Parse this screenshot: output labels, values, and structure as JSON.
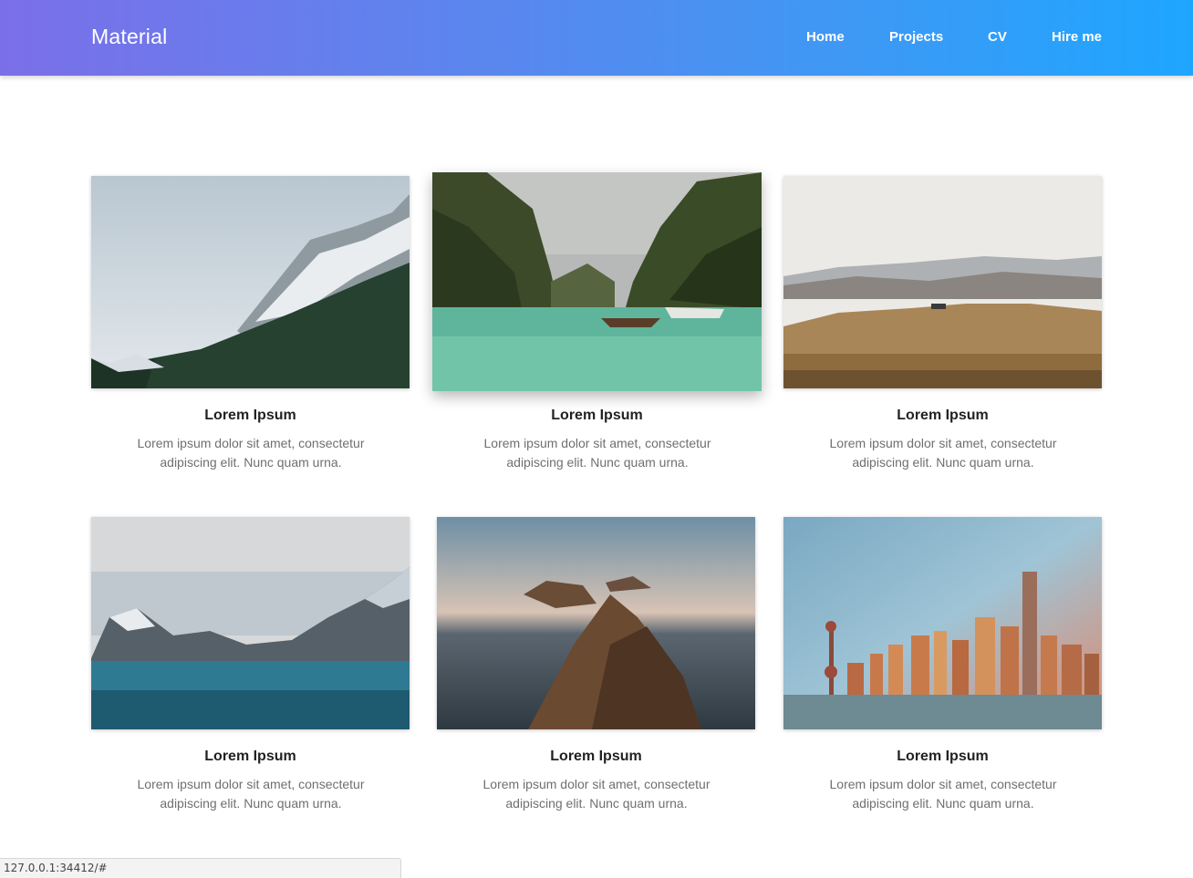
{
  "header": {
    "brand": "Material",
    "nav": [
      "Home",
      "Projects",
      "CV",
      "Hire me"
    ]
  },
  "cards": [
    {
      "title": "Lorem Ipsum",
      "text": "Lorem ipsum dolor sit amet, consectetur adipiscing elit. Nunc quam urna."
    },
    {
      "title": "Lorem Ipsum",
      "text": "Lorem ipsum dolor sit amet, consectetur adipiscing elit. Nunc quam urna."
    },
    {
      "title": "Lorem Ipsum",
      "text": "Lorem ipsum dolor sit amet, consectetur adipiscing elit. Nunc quam urna."
    },
    {
      "title": "Lorem Ipsum",
      "text": "Lorem ipsum dolor sit amet, consectetur adipiscing elit. Nunc quam urna."
    },
    {
      "title": "Lorem Ipsum",
      "text": "Lorem ipsum dolor sit amet, consectetur adipiscing elit. Nunc quam urna."
    },
    {
      "title": "Lorem Ipsum",
      "text": "Lorem ipsum dolor sit amet, consectetur adipiscing elit. Nunc quam urna."
    }
  ],
  "status_url": "127.0.0.1:34412/#",
  "colors": {
    "header_gradient_start": "#7b6fe9",
    "header_gradient_end": "#1ea6ff",
    "title_text": "#222222",
    "body_text": "#6f6f6f"
  }
}
